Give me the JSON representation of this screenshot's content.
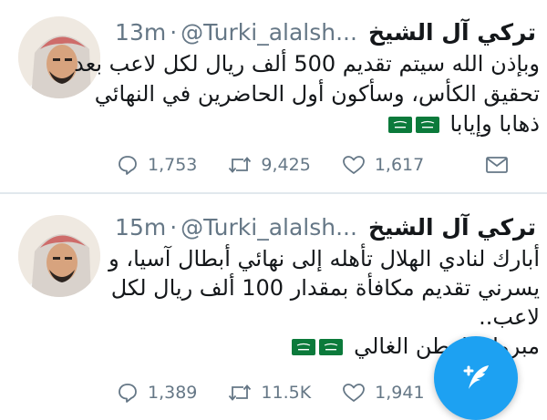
{
  "tweets": [
    {
      "name": "تركي آل الشيخ",
      "handle": "@Turki_alalsh...",
      "separator": "·",
      "time": "13m",
      "lines": [
        "وبإذن الله سيتم تقديم 500 ألف ريال لكل لاعب بعد",
        "تحقيق الكأس، وسأكون أول الحاضرين في النهائي",
        "ذهابا وإيابا"
      ],
      "flag_icon": "saudi-flag-icon",
      "reply_icon": "reply-icon",
      "reply_count": "1,753",
      "retweet_icon": "retweet-icon",
      "retweet_count": "9,425",
      "like_icon": "heart-icon",
      "like_count": "1,617",
      "share_icon": "mail-icon"
    },
    {
      "name": "تركي آل الشيخ",
      "handle": "@Turki_alalsh...",
      "separator": "·",
      "time": "15m",
      "lines": [
        "أبارك لنادي الهلال تأهله إلى نهائي أبطال آسيا، و",
        "يسرني تقديم مكافأة بمقدار 100 ألف ريال لكل",
        "لاعب..",
        "مبروك الوطن الغالي"
      ],
      "flag_icon": "saudi-flag-icon",
      "reply_icon": "reply-icon",
      "reply_count": "1,389",
      "retweet_icon": "retweet-icon",
      "retweet_count": "11.5K",
      "like_icon": "heart-icon",
      "like_count": "1,941"
    }
  ],
  "compose_button_icon": "compose-tweet-icon",
  "colors": {
    "accent": "#1da1f2",
    "text": "#14171a",
    "secondary": "#657786",
    "divider": "#e1e8ed",
    "flag_green": "#0b7a3b"
  }
}
